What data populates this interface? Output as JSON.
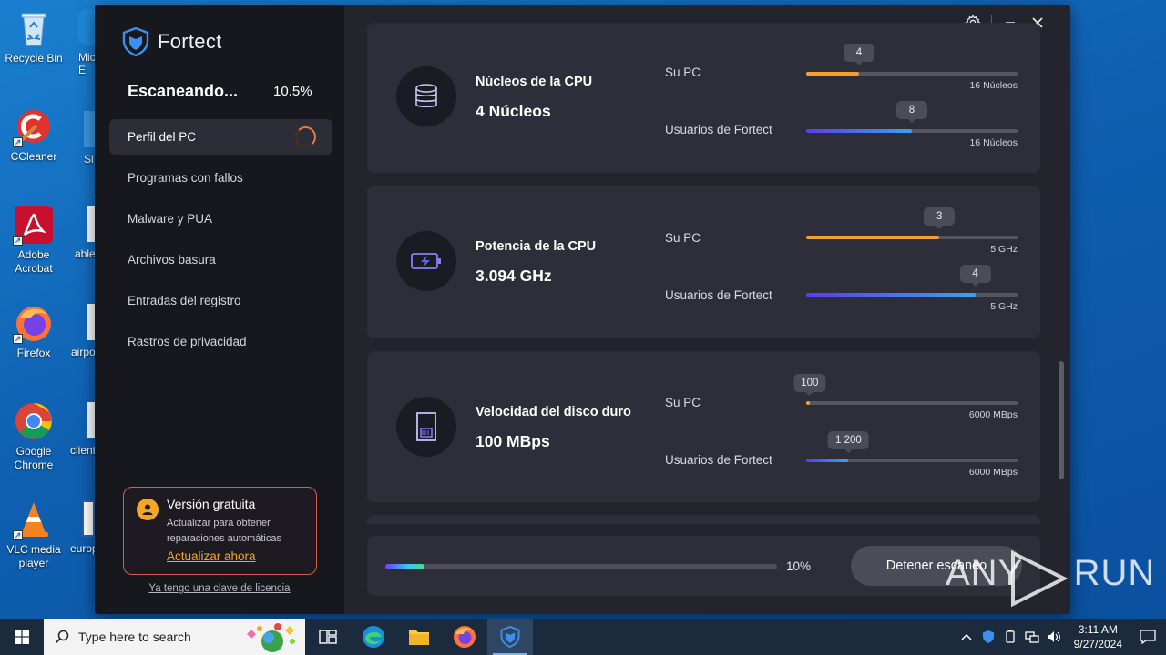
{
  "desktop": {
    "icons": [
      {
        "label": "Recycle Bin"
      },
      {
        "label": "CCleaner"
      },
      {
        "label": "Adobe Acrobat"
      },
      {
        "label": "Firefox"
      },
      {
        "label": "Google Chrome"
      },
      {
        "label": "VLC media player"
      }
    ],
    "partial_icons": [
      {
        "label": "Mic\nE"
      },
      {
        "label": "Sl"
      },
      {
        "label": "able"
      },
      {
        "label": "airpo"
      },
      {
        "label": "client"
      },
      {
        "label": "europ"
      }
    ]
  },
  "app": {
    "name": "Fortect",
    "scan": {
      "title": "Escaneando...",
      "percent": "10.5%"
    },
    "nav": [
      {
        "label": "Perfil del PC",
        "active": true
      },
      {
        "label": "Programas con fallos"
      },
      {
        "label": "Malware y PUA"
      },
      {
        "label": "Archivos basura"
      },
      {
        "label": "Entradas del registro"
      },
      {
        "label": "Rastros de privacidad"
      }
    ],
    "promo": {
      "title": "Versión gratuita",
      "text": "Actualizar para obtener reparaciones automáticas",
      "link": "Actualizar ahora"
    },
    "license_link": "Ya tengo una clave de licencia",
    "cards": [
      {
        "name": "Núcleos de la CPU",
        "value": "4 Núcleos",
        "icon": "database-icon",
        "rows": [
          {
            "label": "Su PC",
            "bubble": "4",
            "fill": 0.25,
            "max": "16 Núcleos",
            "color": "orange"
          },
          {
            "label": "Usuarios de Fortect",
            "bubble": "8",
            "fill": 0.5,
            "max": "16 Núcleos",
            "color": "blue"
          }
        ]
      },
      {
        "name": "Potencia de la CPU",
        "value": "3.094 GHz",
        "icon": "battery-bolt-icon",
        "rows": [
          {
            "label": "Su PC",
            "bubble": "3",
            "fill": 0.63,
            "max": "5 GHz",
            "color": "orange"
          },
          {
            "label": "Usuarios de Fortect",
            "bubble": "4",
            "fill": 0.8,
            "max": "5 GHz",
            "color": "blue"
          }
        ]
      },
      {
        "name": "Velocidad del disco duro",
        "value": "100 MBps",
        "icon": "sd-card-icon",
        "rows": [
          {
            "label": "Su PC",
            "bubble": "100",
            "fill": 0.0167,
            "max": "6000 MBps",
            "color": "orange"
          },
          {
            "label": "Usuarios de Fortect",
            "bubble": "1 200",
            "fill": 0.2,
            "max": "6000 MBps",
            "color": "blue"
          }
        ]
      }
    ],
    "progress": {
      "fill": 0.1,
      "label": "10%"
    },
    "stop_button": "Detener escaneo"
  },
  "watermark": "ANY RUN",
  "taskbar": {
    "search_placeholder": "Type here to search",
    "time": "3:11 AM",
    "date": "9/27/2024"
  },
  "colors": {
    "accent_orange": "#f5a02a",
    "accent_blue": "#3aa2ee",
    "promo_border": "#d95a4a"
  }
}
